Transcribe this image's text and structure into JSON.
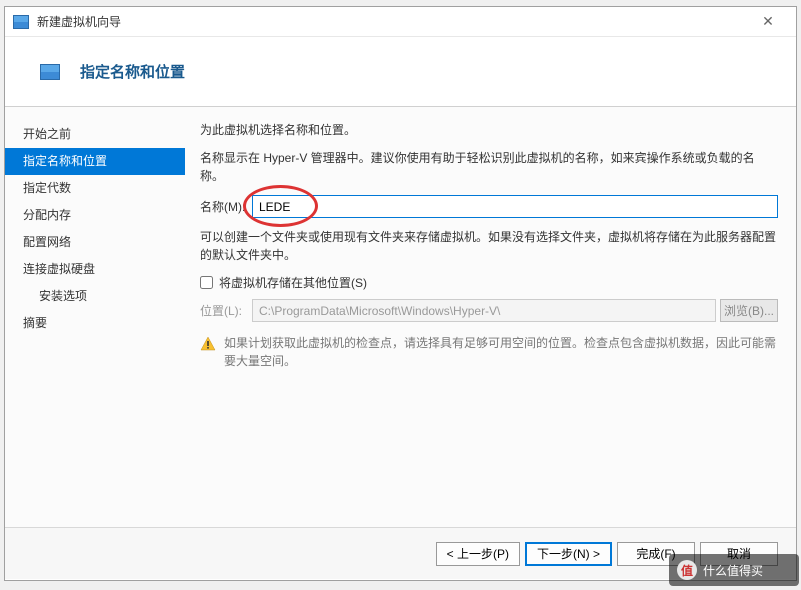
{
  "titlebar": {
    "title": "新建虚拟机向导"
  },
  "header": {
    "title": "指定名称和位置"
  },
  "sidebar": {
    "items": [
      {
        "label": "开始之前",
        "selected": false,
        "indent": false
      },
      {
        "label": "指定名称和位置",
        "selected": true,
        "indent": false
      },
      {
        "label": "指定代数",
        "selected": false,
        "indent": false
      },
      {
        "label": "分配内存",
        "selected": false,
        "indent": false
      },
      {
        "label": "配置网络",
        "selected": false,
        "indent": false
      },
      {
        "label": "连接虚拟硬盘",
        "selected": false,
        "indent": false
      },
      {
        "label": "安装选项",
        "selected": false,
        "indent": true
      },
      {
        "label": "摘要",
        "selected": false,
        "indent": false
      }
    ]
  },
  "content": {
    "line1": "为此虚拟机选择名称和位置。",
    "line2": "名称显示在 Hyper-V 管理器中。建议你使用有助于轻松识别此虚拟机的名称，如来宾操作系统或负载的名称。",
    "name_label": "名称(M):",
    "name_value": "LEDE",
    "line3": "可以创建一个文件夹或使用现有文件夹来存储虚拟机。如果没有选择文件夹，虚拟机将存储在为此服务器配置的默认文件夹中。",
    "checkbox_label": "将虚拟机存储在其他位置(S)",
    "checkbox_checked": false,
    "location_label": "位置(L):",
    "location_value": "C:\\ProgramData\\Microsoft\\Windows\\Hyper-V\\",
    "browse_label": "浏览(B)...",
    "warn_text": "如果计划获取此虚拟机的检查点，请选择具有足够可用空间的位置。检查点包含虚拟机数据，因此可能需要大量空间。"
  },
  "footer": {
    "prev": "< 上一步(P)",
    "next": "下一步(N) >",
    "finish": "完成(F)",
    "cancel": "取消"
  },
  "watermark": {
    "text": "什么值得买"
  }
}
